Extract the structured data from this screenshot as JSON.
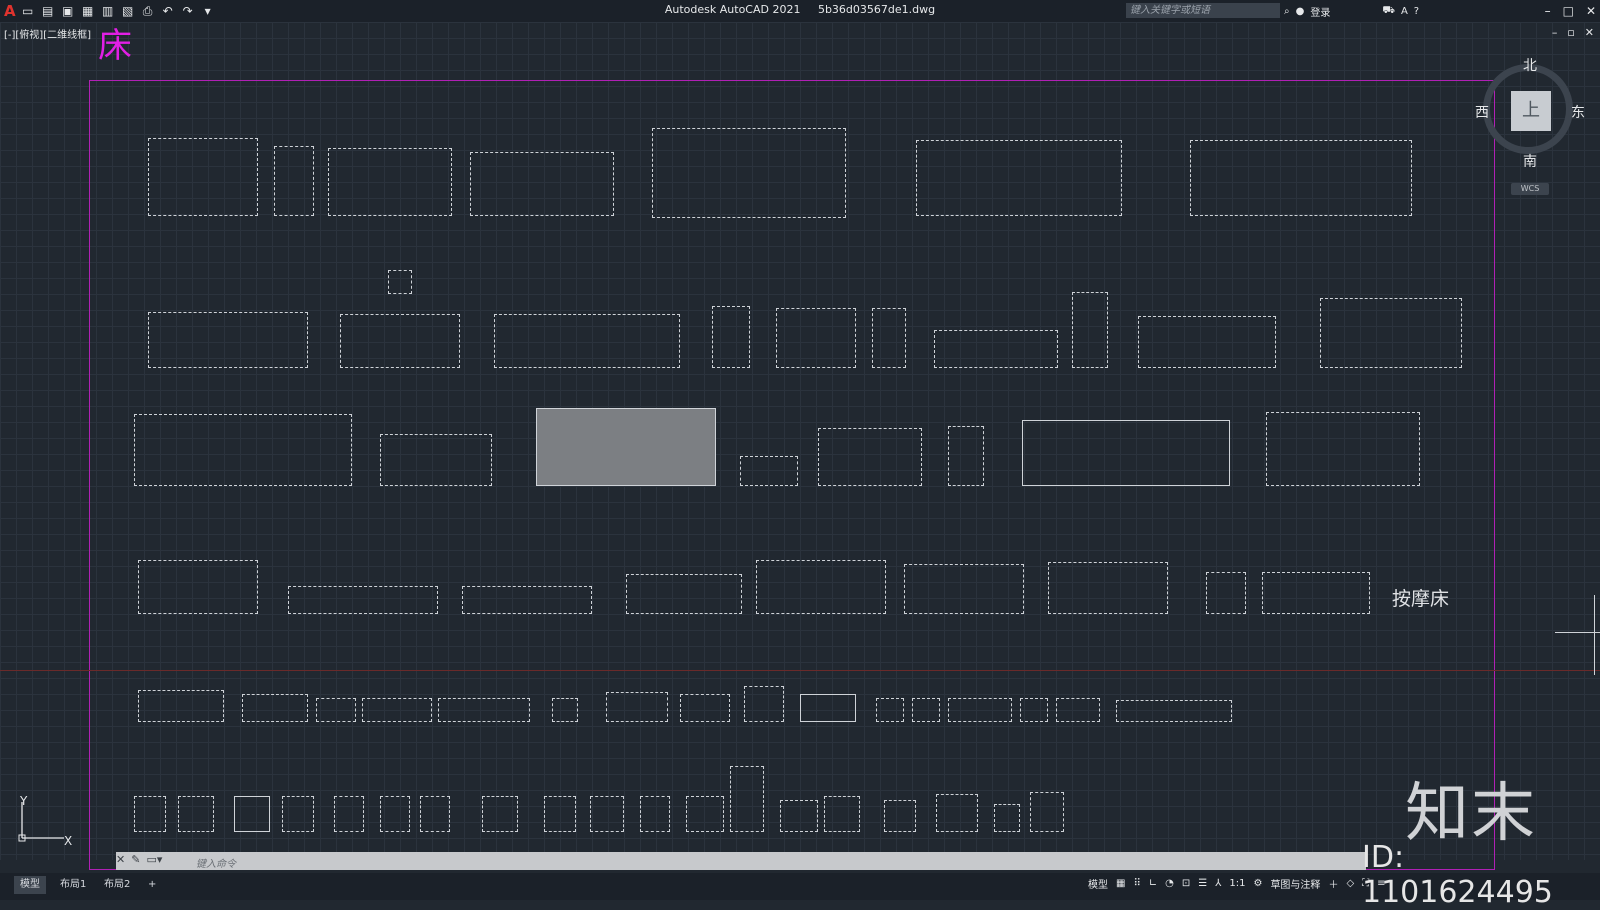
{
  "app": {
    "title": "Autodesk AutoCAD 2021",
    "file": "5b36d03567de1.dwg",
    "search_placeholder": "键入关键字或短语",
    "login": "登录"
  },
  "viewport": {
    "view_label": "[-][俯视][二维线框]",
    "drawing_title": "床",
    "massage_bed_label": "按摩床"
  },
  "viewcube": {
    "north": "北",
    "south": "南",
    "east": "东",
    "west": "西",
    "face": "上",
    "wcs": "WCS"
  },
  "ucs": {
    "x": "X",
    "y": "Y"
  },
  "command": {
    "prompt": "键入命令"
  },
  "layout_tabs": [
    {
      "label": "模型",
      "active": true
    },
    {
      "label": "布局1",
      "active": false
    },
    {
      "label": "布局2",
      "active": false
    }
  ],
  "status": {
    "model": "模型",
    "scale": "1:1",
    "workspace": "草图与注释"
  },
  "watermark": {
    "logo": "知末",
    "id": "ID: 1101624495"
  }
}
